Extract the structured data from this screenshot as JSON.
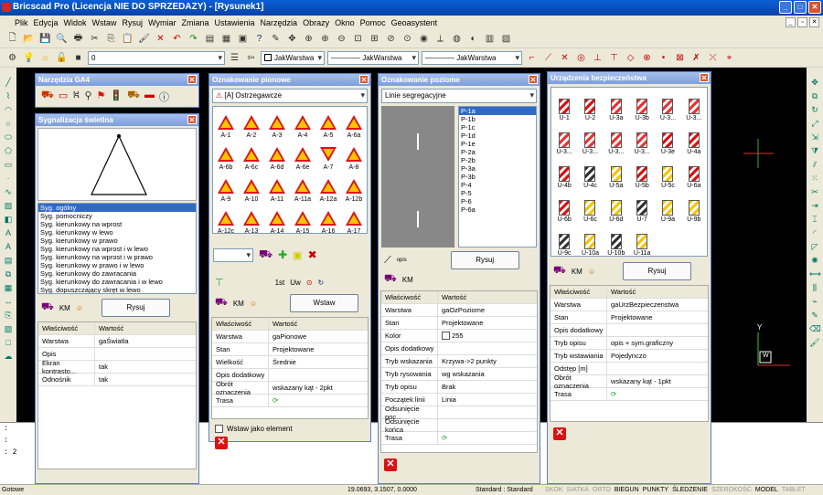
{
  "window": {
    "title": "Bricscad Pro (Licencja NIE DO SPRZEDAZY) - [Rysunek1]"
  },
  "menu": [
    "Plik",
    "Edycja",
    "Widok",
    "Wstaw",
    "Rysuj",
    "Wymiar",
    "Zmiana",
    "Ustawienia",
    "Narzędzia",
    "Obrazy",
    "Okno",
    "Pomoc",
    "Geoasystent"
  ],
  "props_toolbar": {
    "layer": "0",
    "color": "JakWarstwa",
    "linetype": "JakWarstwa",
    "lineweight": "JakWarstwa"
  },
  "ga4": {
    "title": "Narzędzia GA4"
  },
  "sygnal": {
    "title": "Sygnalizacja świetlna",
    "items": [
      "Syg. ogólny",
      "Syg. pomocniczy",
      "Syg. kierunkowy na wprost",
      "Syg. kierunkowy w lewo",
      "Syg. kierunkowy w prawo",
      "Syg. kierunkowy na wprost i w lewo",
      "Syg. kierunkowy na wprost i w prawo",
      "Syg. kierunkowy w prawo i w lewo",
      "Syg. kierunkowy do zawracania",
      "Syg. kierunkowy do zawracania i w lewo",
      "Syg. dopuszczający skręt w lewo"
    ],
    "km": "KM",
    "draw": "Rysuj",
    "col_prop": "Właściwość",
    "col_val": "Wartość",
    "props": [
      {
        "k": "Warstwa",
        "v": "gaŚwiatla"
      },
      {
        "k": "Opis",
        "v": ""
      },
      {
        "k": "Ekran kontrasto...",
        "v": "tak"
      },
      {
        "k": "Odnośnik",
        "v": "tak"
      }
    ]
  },
  "pionowe": {
    "title": "Oznakowanie pionowe",
    "category": "[A] Ostrzegawcze",
    "signs": [
      "A-1",
      "A-2",
      "A-3",
      "A-4",
      "A-5",
      "A-6a",
      "A-6b",
      "A-6c",
      "A-6d",
      "A-6e",
      "A-7",
      "A-8",
      "A-9",
      "A-10",
      "A-11",
      "A-11a",
      "A-12a",
      "A-12b",
      "A-12c",
      "A-13",
      "A-14",
      "A-15",
      "A-16",
      "A-17"
    ],
    "tool_labels": [
      "1st",
      "Uw"
    ],
    "km": "KM",
    "insert": "Wstaw",
    "col_prop": "Właściwość",
    "col_val": "Wartość",
    "props": [
      {
        "k": "Warstwa",
        "v": "gaPionowe"
      },
      {
        "k": "Stan",
        "v": "Projektowane"
      },
      {
        "k": "Wielkość",
        "v": "Średnie"
      },
      {
        "k": "Opis dodatkowy",
        "v": ""
      },
      {
        "k": "Obrót oznaczenia",
        "v": "wskazany kąt - 2pkt"
      },
      {
        "k": "Trasa",
        "v": ""
      }
    ],
    "checkbox": "Wstaw jako element"
  },
  "poziome": {
    "title": "Oznakowanie poziome",
    "category": "Linie segregacyjne",
    "items": [
      "P-1a",
      "P-1b",
      "P-1c",
      "P-1d",
      "P-1e",
      "P-2a",
      "P-2b",
      "P-3a",
      "P-3b",
      "P-4",
      "P-5",
      "P-6",
      "P-6a"
    ],
    "opis": "opis",
    "km": "KM",
    "draw": "Rysuj",
    "col_prop": "Właściwość",
    "col_val": "Wartość",
    "props": [
      {
        "k": "Warstwa",
        "v": "gaOzPoziome"
      },
      {
        "k": "Stan",
        "v": "Projektowane"
      },
      {
        "k": "Kolor",
        "v": "255"
      },
      {
        "k": "Opis dodatkowy",
        "v": ""
      },
      {
        "k": "Tryb wskazania",
        "v": "Krzywa->2 punkty"
      },
      {
        "k": "Tryb rysowania",
        "v": "wg wskazania"
      },
      {
        "k": "Tryb opisu",
        "v": "Brak"
      },
      {
        "k": "Początek linii",
        "v": "Linia"
      },
      {
        "k": "Odsunięcie poc...",
        "v": ""
      },
      {
        "k": "Odsunięcie końca",
        "v": ""
      },
      {
        "k": "Trasa",
        "v": ""
      }
    ]
  },
  "urzadzenia": {
    "title": "Urządzenia bezpieczeństwa",
    "devices": [
      "U-1",
      "U-2",
      "U-3a",
      "U-3b",
      "U-3...",
      "U-3...",
      "U-3...",
      "U-3...",
      "U-3...",
      "U-3...",
      "U-3e",
      "U-4a",
      "U-4b",
      "U-4c",
      "U-5a",
      "U-5b",
      "U-5c",
      "U-6a",
      "U-6b",
      "U-6c",
      "U-6d",
      "U-7",
      "U-9a",
      "U-9b",
      "U-9c",
      "U-10a",
      "U-10b",
      "U-11a"
    ],
    "km": "KM",
    "draw": "Rysuj",
    "col_prop": "Właściwość",
    "col_val": "Wartość",
    "props": [
      {
        "k": "Warstwa",
        "v": "gaUrzBezpieczenstwa"
      },
      {
        "k": "Stan",
        "v": "Projektowane"
      },
      {
        "k": "Opis dodatkowy",
        "v": ""
      },
      {
        "k": "Tryb opisu",
        "v": "opis + sym.graficzny"
      },
      {
        "k": "Tryb wstawiania",
        "v": "Pojedynczo"
      },
      {
        "k": "Odstęp [m]",
        "v": ""
      },
      {
        "k": "Obrót oznaczenia",
        "v": "wskazany kąt - 1pkt"
      },
      {
        "k": "Trasa",
        "v": ""
      }
    ]
  },
  "command": {
    "lines": [
      ":",
      ":",
      ": 2"
    ]
  },
  "status": {
    "left": "Gotowe",
    "coords": "19.0693, 3.1507, 0.0000",
    "style": "Standard : Standard",
    "modes": [
      "SKOK",
      "SIATKA",
      "ORTO",
      "BIEGUN",
      "PUNKTY",
      "ŚLEDZENIE",
      "SZEROKOŚĆ",
      "MODEL",
      "TABLET"
    ]
  },
  "axis": {
    "y": "Y",
    "w": "W"
  }
}
